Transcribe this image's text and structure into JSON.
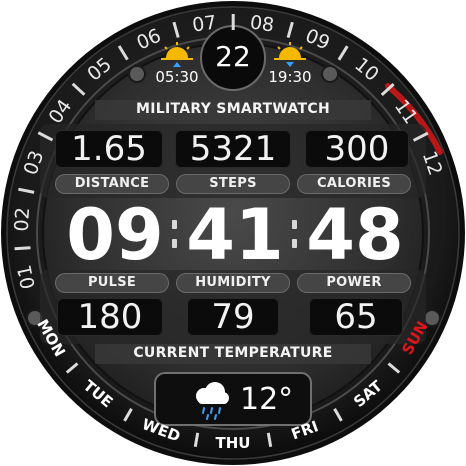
{
  "watch": {
    "title": "MILITARY SMARTWATCH",
    "date_day": "22",
    "sunrise": "05:30",
    "sunset": "19:30",
    "stats_top": [
      {
        "value": "1.65",
        "label": "DISTANCE"
      },
      {
        "value": "5321",
        "label": "STEPS"
      },
      {
        "value": "300",
        "label": "CALORIES"
      }
    ],
    "time": {
      "hours": "09",
      "minutes": "41",
      "seconds": "48"
    },
    "stats_bottom": [
      {
        "value": "180",
        "label": "PULSE"
      },
      {
        "value": "79",
        "label": "HUMIDITY"
      },
      {
        "value": "65",
        "label": "POWER"
      }
    ],
    "temperature_label": "CURRENT TEMPERATURE",
    "temperature": "12°",
    "weather_icon": "rain-cloud-icon",
    "bezel_numbers": [
      "01",
      "02",
      "03",
      "04",
      "05",
      "06",
      "07",
      "08",
      "09",
      "10",
      "11",
      "12"
    ],
    "weekdays": [
      "MON",
      "TUE",
      "WED",
      "THU",
      "FRI",
      "SAT",
      "SUN"
    ],
    "active_weekday": "SUN",
    "colors": {
      "accent_red": "#e0141a",
      "weekday_active": "#e0141a",
      "weekday": "#ffffff",
      "sun": "#f5b800",
      "rain": "#3aa0ff"
    }
  }
}
